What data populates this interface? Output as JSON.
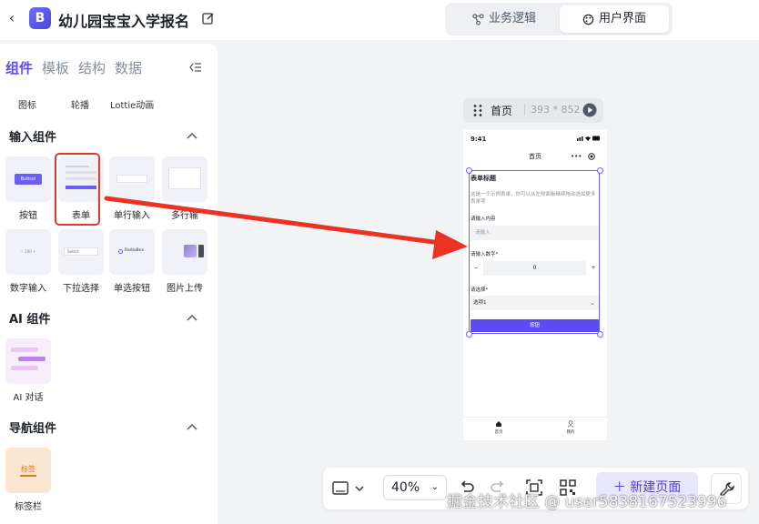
{
  "header": {
    "back_icon": "chevron-left-icon",
    "app_title": "幼儿园宝宝入学报名",
    "mode_logic": "业务逻辑",
    "mode_ui": "用户界面",
    "accent": "#5b4cf0"
  },
  "panel": {
    "tabs": [
      "组件",
      "模板",
      "结构",
      "数据"
    ],
    "media_items": [
      "图标",
      "轮播",
      "Lottie动画"
    ],
    "sections": {
      "input": "输入组件",
      "ai": "AI 组件",
      "nav": "导航组件"
    },
    "input_components": [
      "按钮",
      "表单",
      "单行输入",
      "多行输",
      "数字输入",
      "下拉选择",
      "单选按钮",
      "图片上传"
    ],
    "ai_components": [
      "AI 对话"
    ],
    "nav_components": [
      "标签栏"
    ],
    "thumb_text": {
      "button": "Button",
      "stepper_value": "100",
      "select": "Select",
      "radiobox": "RadioBox",
      "tabs": "标签"
    },
    "selected": "表单"
  },
  "page_bar": {
    "name": "首页",
    "size": "393 * 852"
  },
  "phone": {
    "time": "9:41",
    "nav_title": "首页",
    "nav_more": "•••",
    "form": {
      "title": "表单标题",
      "description": "这是一个示例表单，你可以从左侧面板继续拖动选如更多表单项",
      "label_text": "请输入内容",
      "text_placeholder": "请输入",
      "label_number": "请输入数字*",
      "minus": "−",
      "number_value": "0",
      "plus": "+",
      "label_select": "请选择*",
      "select_value": "选项1",
      "submit": "按钮"
    },
    "tabbar": [
      "首页",
      "我的"
    ]
  },
  "toolbar": {
    "zoom": "40%",
    "new_page": "新建页面",
    "new_page_icon": "plus-icon"
  },
  "watermark": "掘金技术社区 @ user5838167523996",
  "annotation": {
    "highlight_color": "#e03a2e"
  }
}
